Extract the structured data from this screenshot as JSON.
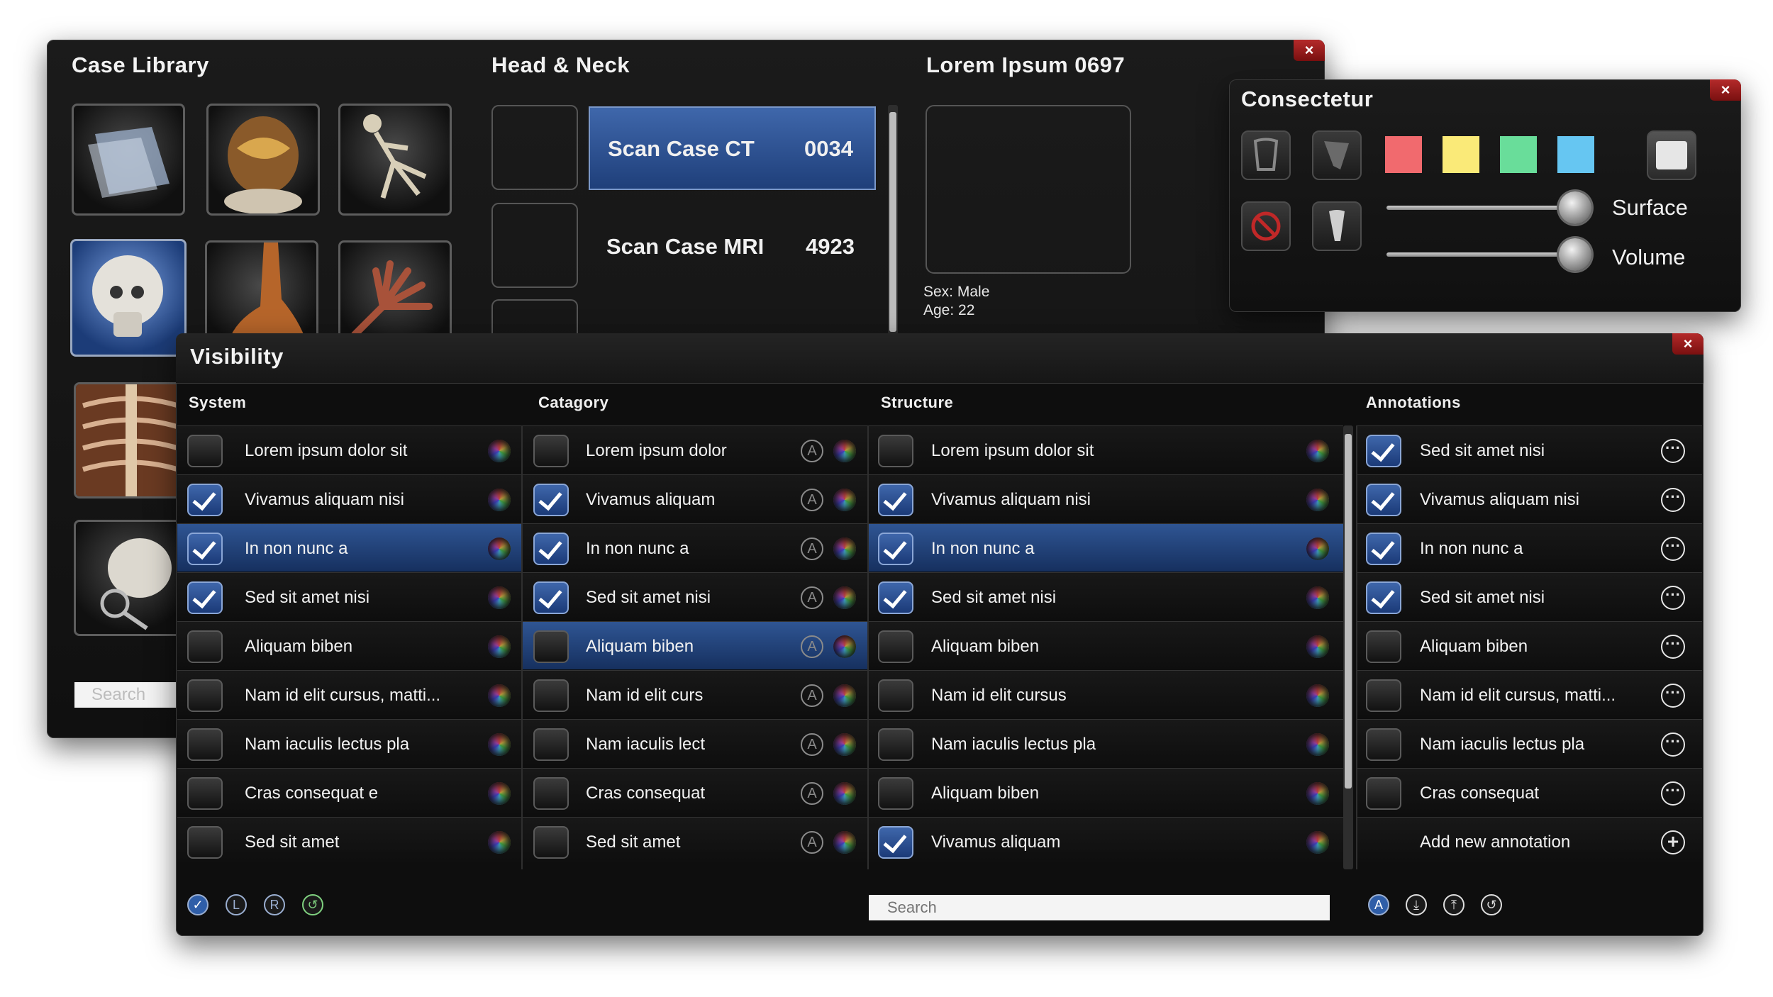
{
  "case_library": {
    "title": "Case Library",
    "thumbnails": [
      "film-scan-thumbnail",
      "abdomen-thumbnail",
      "skeleton-thumbnail",
      "skull-thumbnail",
      "foot-thumbnail",
      "hand-thumbnail",
      "ribcage-thumbnail",
      "skull-magnifier-thumbnail"
    ],
    "search_placeholder": "Search"
  },
  "head_neck": {
    "title": "Head & Neck",
    "cases": [
      {
        "name": "Scan Case CT",
        "number": "0034",
        "selected": true
      },
      {
        "name": "Scan Case MRI",
        "number": "4923",
        "selected": false
      }
    ]
  },
  "patient": {
    "title": "Lorem Ipsum 0697",
    "sex": "Sex: Male",
    "age": "Age: 22"
  },
  "consectetur": {
    "title": "Consectetur",
    "swatches": [
      "#f16a6e",
      "#faea78",
      "#69dd9a",
      "#66c6f2"
    ],
    "surface_label": "Surface",
    "volume_label": "Volume",
    "surface_value": 1.0,
    "volume_value": 1.0
  },
  "visibility": {
    "title": "Visibility",
    "headers": {
      "system": "System",
      "category": "Catagory",
      "structure": "Structure",
      "annotations": "Annotations"
    },
    "system": [
      {
        "label": "Lorem ipsum dolor sit",
        "checked": false
      },
      {
        "label": "Vivamus aliquam nisi",
        "checked": true
      },
      {
        "label": "In non nunc a",
        "checked": true,
        "highlight": true
      },
      {
        "label": "Sed sit amet nisi",
        "checked": true
      },
      {
        "label": "Aliquam biben",
        "checked": false
      },
      {
        "label": "Nam id elit cursus, matti...",
        "checked": false
      },
      {
        "label": "Nam iaculis lectus pla",
        "checked": false
      },
      {
        "label": "Cras consequat e",
        "checked": false
      },
      {
        "label": "Sed sit amet",
        "checked": false
      }
    ],
    "category": [
      {
        "label": "Lorem ipsum dolor",
        "checked": false
      },
      {
        "label": "Vivamus aliquam",
        "checked": true
      },
      {
        "label": "In non nunc a",
        "checked": true
      },
      {
        "label": "Sed sit amet nisi",
        "checked": true
      },
      {
        "label": "Aliquam biben",
        "checked": false,
        "highlight": true
      },
      {
        "label": "Nam id elit curs",
        "checked": false
      },
      {
        "label": "Nam iaculis lect",
        "checked": false
      },
      {
        "label": "Cras consequat",
        "checked": false
      },
      {
        "label": "Sed sit amet",
        "checked": false
      }
    ],
    "structure": [
      {
        "label": "Lorem ipsum dolor sit",
        "checked": false
      },
      {
        "label": "Vivamus aliquam nisi",
        "checked": true
      },
      {
        "label": "In non nunc a",
        "checked": true,
        "highlight": true
      },
      {
        "label": "Sed sit amet nisi",
        "checked": true
      },
      {
        "label": "Aliquam biben",
        "checked": false
      },
      {
        "label": "Nam id elit cursus",
        "checked": false
      },
      {
        "label": "Nam iaculis lectus pla",
        "checked": false
      },
      {
        "label": "Aliquam biben",
        "checked": false
      },
      {
        "label": "Vivamus aliquam",
        "checked": true
      }
    ],
    "annotations": [
      {
        "label": "Sed sit amet nisi",
        "checked": true
      },
      {
        "label": "Vivamus aliquam nisi",
        "checked": true
      },
      {
        "label": "In non nunc a",
        "checked": true
      },
      {
        "label": "Sed sit amet nisi",
        "checked": true
      },
      {
        "label": "Aliquam biben",
        "checked": false
      },
      {
        "label": "Nam id elit cursus, matti...",
        "checked": false
      },
      {
        "label": "Nam iaculis lectus pla",
        "checked": false
      },
      {
        "label": "Cras consequat",
        "checked": false
      }
    ],
    "add_annotation_label": "Add new annotation",
    "badge_letter": "A",
    "search_placeholder": "Search",
    "footer_left_icons": [
      "check-all-icon",
      "left-l-icon",
      "right-r-icon",
      "reset-icon"
    ],
    "footer_left_letters": {
      "l": "L",
      "r": "R"
    },
    "footer_right_icons": [
      "annotation-a-icon",
      "download-icon",
      "upload-icon",
      "reset-icon"
    ]
  }
}
